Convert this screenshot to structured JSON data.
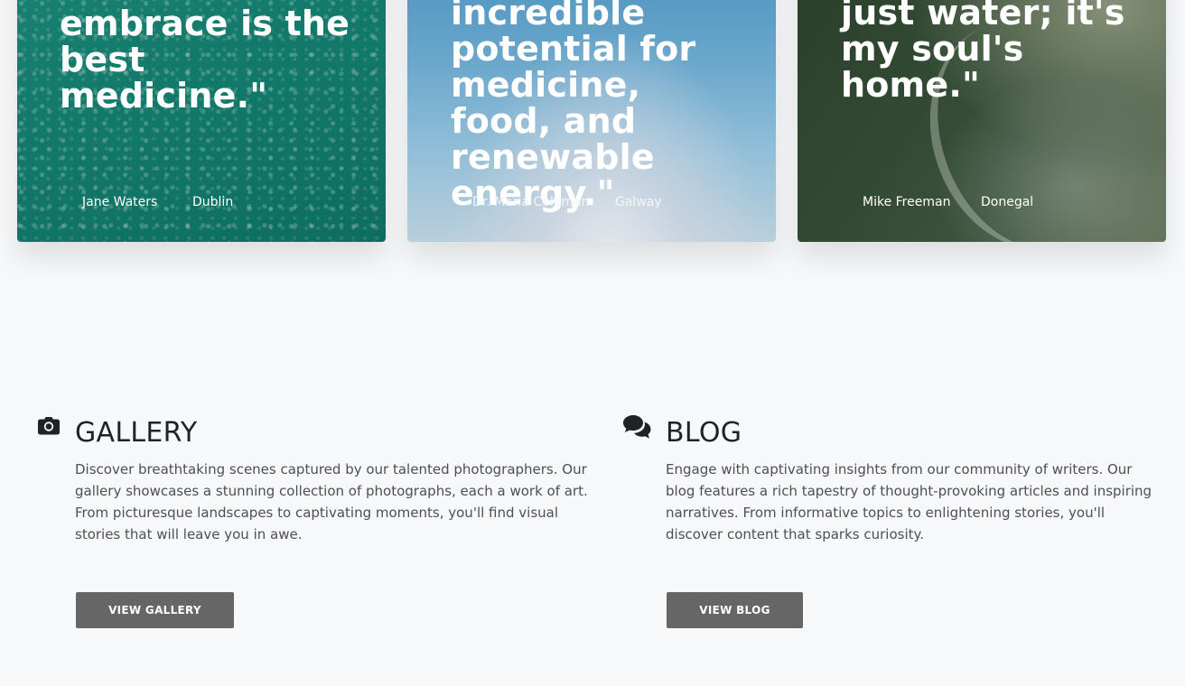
{
  "testimonials": [
    {
      "quote": "reminder that nature's embrace is the best medicine.\"",
      "author": "Jane Waters",
      "location": "Dublin"
    },
    {
      "quote": "incredible potential for medicine, food, and renewable energy.\"",
      "author": "Dr. Maria Coleman",
      "location": "Galway"
    },
    {
      "quote": "The ocean isn't just water; it's my soul's home.\"",
      "author": "Mike Freeman",
      "location": "Donegal"
    }
  ],
  "gallery": {
    "icon": "camera-icon",
    "title": "GALLERY",
    "description": "Discover breathtaking scenes captured by our talented photographers. Our gallery showcases a stunning collection of photographs, each a work of art. From picturesque landscapes to captivating moments, you'll find visual stories that will leave you in awe.",
    "button_label": "VIEW GALLERY"
  },
  "blog": {
    "icon": "comments-icon",
    "title": "BLOG",
    "description": "Engage with captivating insights from our community of writers. Our blog features a rich tapestry of thought-provoking articles and inspiring narratives. From informative topics to enlightening stories, you'll discover content that sparks curiosity.",
    "button_label": "VIEW BLOG"
  },
  "colors": {
    "page_background": "#f7f8fa",
    "button_background": "#666666",
    "heading_text": "#1f2328",
    "body_text": "#4d4f53"
  }
}
